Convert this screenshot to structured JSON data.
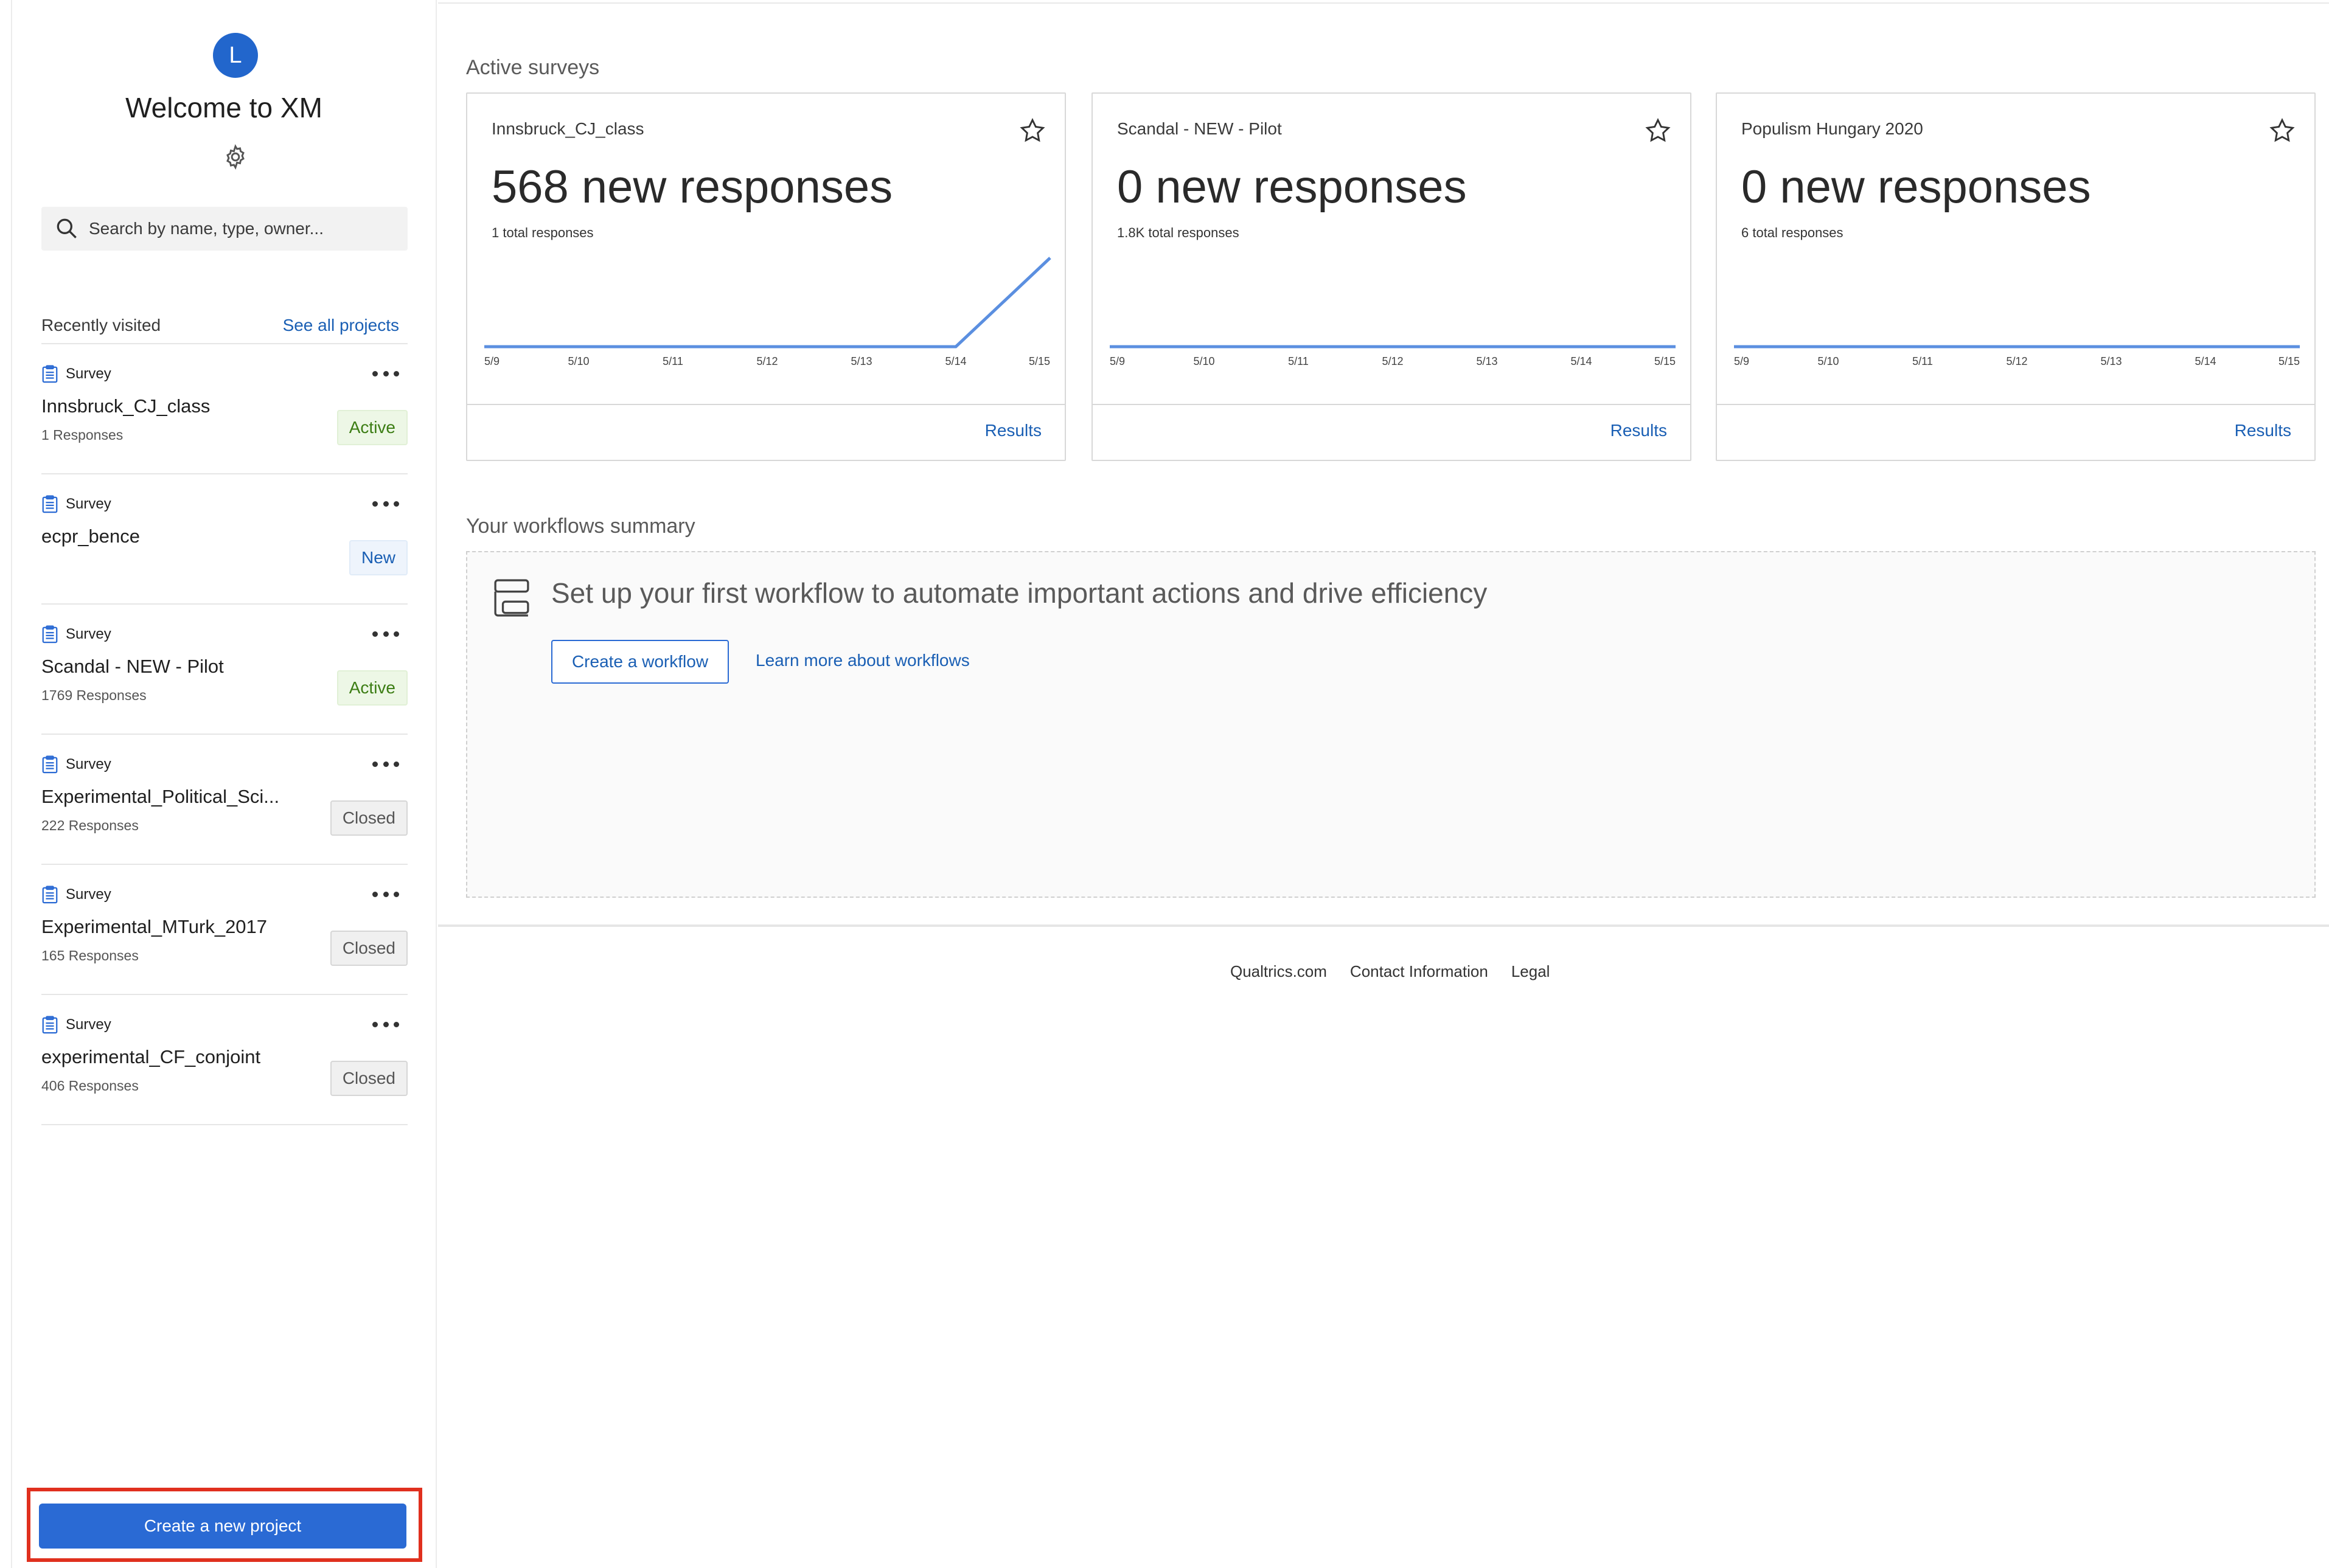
{
  "sidebar": {
    "avatar_letter": "L",
    "welcome": "Welcome to XM",
    "search_placeholder": "Search by name, type, owner...",
    "recent_title": "Recently visited",
    "see_all": "See all projects",
    "projects": [
      {
        "type": "Survey",
        "name": "Innsbruck_CJ_class",
        "responses": "1 Responses",
        "status": "Active"
      },
      {
        "type": "Survey",
        "name": "ecpr_bence",
        "responses": "",
        "status": "New"
      },
      {
        "type": "Survey",
        "name": "Scandal - NEW - Pilot",
        "responses": "1769 Responses",
        "status": "Active"
      },
      {
        "type": "Survey",
        "name": "Experimental_Political_Sci...",
        "responses": "222 Responses",
        "status": "Closed"
      },
      {
        "type": "Survey",
        "name": "Experimental_MTurk_2017",
        "responses": "165 Responses",
        "status": "Closed"
      },
      {
        "type": "Survey",
        "name": "experimental_CF_conjoint",
        "responses": "406 Responses",
        "status": "Closed"
      }
    ],
    "create_button": "Create a new project"
  },
  "main": {
    "active_title": "Active surveys",
    "cards": [
      {
        "name": "Innsbruck_CJ_class",
        "new_responses": "568 new responses",
        "total": "1 total responses",
        "results": "Results"
      },
      {
        "name": "Scandal - NEW - Pilot",
        "new_responses": "0 new responses",
        "total": "1.8K total responses",
        "results": "Results"
      },
      {
        "name": "Populism Hungary 2020",
        "new_responses": "0 new responses",
        "total": "6 total responses",
        "results": "Results"
      }
    ],
    "workflows_title": "Your workflows summary",
    "workflow_text": "Set up your first workflow to automate important actions and drive efficiency",
    "create_workflow": "Create a workflow",
    "learn_more": "Learn more about workflows"
  },
  "footer": {
    "links": [
      "Qualtrics.com",
      "Contact Information",
      "Legal"
    ]
  },
  "chart_data": [
    {
      "type": "line",
      "x": [
        "5/9",
        "5/10",
        "5/11",
        "5/12",
        "5/13",
        "5/14",
        "5/15"
      ],
      "series": [
        {
          "values": [
            0,
            0,
            0,
            0,
            0,
            0,
            568
          ]
        }
      ],
      "ylim": [
        0,
        568
      ]
    },
    {
      "type": "line",
      "x": [
        "5/9",
        "5/10",
        "5/11",
        "5/12",
        "5/13",
        "5/14",
        "5/15"
      ],
      "series": [
        {
          "values": [
            0,
            0,
            0,
            0,
            0,
            0,
            0
          ]
        }
      ],
      "ylim": [
        0,
        568
      ]
    },
    {
      "type": "line",
      "x": [
        "5/9",
        "5/10",
        "5/11",
        "5/12",
        "5/13",
        "5/14",
        "5/15"
      ],
      "series": [
        {
          "values": [
            0,
            0,
            0,
            0,
            0,
            0,
            0
          ]
        }
      ],
      "ylim": [
        0,
        568
      ]
    }
  ],
  "colors": {
    "line": "#5b8fe0",
    "brand_blue": "#2a6ad4",
    "highlight": "#e0301e"
  }
}
